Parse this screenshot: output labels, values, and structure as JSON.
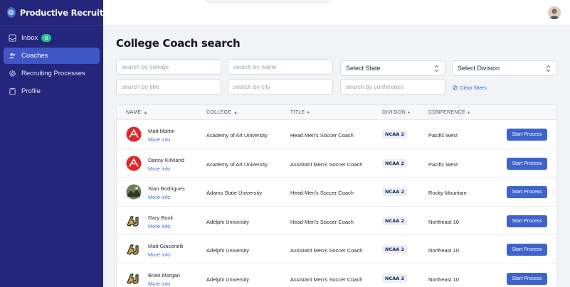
{
  "app": {
    "name": "Productive Recruit"
  },
  "sidebar": {
    "items": [
      {
        "label": "Inbox",
        "badge": "0",
        "icon": "inbox-icon"
      },
      {
        "label": "Coaches",
        "icon": "users-icon"
      },
      {
        "label": "Recruiting Processes",
        "icon": "gear-icon"
      },
      {
        "label": "Profile",
        "icon": "clipboard-icon"
      }
    ],
    "active": "Coaches"
  },
  "page": {
    "title": "College Coach search"
  },
  "filters": {
    "college_placeholder": "search by college",
    "name_placeholder": "search by name",
    "state_label": "Select State",
    "division_label": "Select Division",
    "title_placeholder": "search by title",
    "city_placeholder": "search by city",
    "conference_placeholder": "search by conference",
    "clear_label": "Clear filters"
  },
  "table": {
    "headers": {
      "name": "NAME",
      "college": "COLLEGE",
      "title": "TITLE",
      "division": "DIVISION",
      "conference": "CONFERENCE"
    },
    "more_info_label": "More info",
    "action_label": "Start Process",
    "rows": [
      {
        "name": "Matt Martin",
        "college": "Academy of Art University",
        "title": "Head Men's Soccer Coach",
        "division": "NCAA 2",
        "conference": "Pacific West",
        "logo": "academy-of-art-logo"
      },
      {
        "name": "Danny Kirkland",
        "college": "Academy of Art University",
        "title": "Assistant Men's Soccer Coach",
        "division": "NCAA 2",
        "conference": "Pacific West",
        "logo": "academy-of-art-logo"
      },
      {
        "name": "Stan Rodrigues",
        "college": "Adams State University",
        "title": "Head Men's Soccer Coach",
        "division": "NCAA 2",
        "conference": "Rocky Mountain",
        "logo": "adams-state-logo"
      },
      {
        "name": "Gary Book",
        "college": "Adelphi University",
        "title": "Head Men's Soccer Coach",
        "division": "NCAA 2",
        "conference": "Northeast 10",
        "logo": "adelphi-logo"
      },
      {
        "name": "Matt Giaconelli",
        "college": "Adelphi University",
        "title": "Assistant Men's Soccer Coach",
        "division": "NCAA 2",
        "conference": "Northeast 10",
        "logo": "adelphi-logo"
      },
      {
        "name": "Brian Morgan",
        "college": "Adelphi University",
        "title": "Assistant Men's Soccer Coach",
        "division": "NCAA 2",
        "conference": "Northeast 10",
        "logo": "adelphi-logo"
      }
    ]
  },
  "colors": {
    "sidebar": "#23267a",
    "accent": "#3e63cc",
    "badge": "#27c08a"
  }
}
